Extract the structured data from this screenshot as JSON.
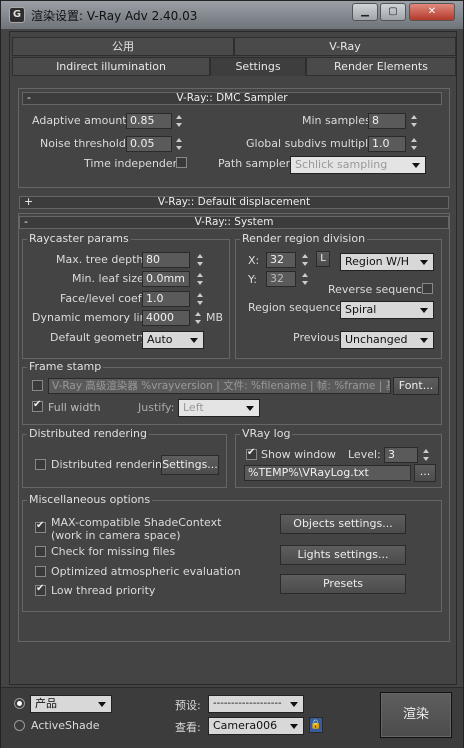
{
  "window": {
    "title": "渲染设置: V-Ray Adv 2.40.03",
    "icon": "3ds-max-icon"
  },
  "tabs_row1": [
    {
      "label": "公用"
    },
    {
      "label": "V-Ray"
    }
  ],
  "tabs_row2": [
    {
      "label": "Indirect illumination"
    },
    {
      "label": "Settings"
    },
    {
      "label": "Render Elements"
    }
  ],
  "dmc": {
    "title": "V-Ray:: DMC Sampler",
    "sign": "-",
    "adaptive_amount_label": "Adaptive amount:",
    "adaptive_amount": "0.85",
    "noise_threshold_label": "Noise threshold:",
    "noise_threshold": "0.05",
    "time_independent_label": "Time independent",
    "time_independent": false,
    "min_samples_label": "Min samples:",
    "min_samples": "8",
    "global_subdivs_label": "Global subdivs multiplier:",
    "global_subdivs": "1.0",
    "path_sampler_label": "Path sampler:",
    "path_sampler": "Schlick sampling"
  },
  "displacement": {
    "title": "V-Ray:: Default displacement",
    "sign": "+"
  },
  "system": {
    "title": "V-Ray:: System",
    "sign": "-",
    "raycaster": {
      "title": "Raycaster params",
      "max_tree_label": "Max. tree depth:",
      "max_tree": "80",
      "min_leaf_label": "Min. leaf size:",
      "min_leaf": "0.0mm",
      "face_level_label": "Face/level coef.",
      "face_level": "1.0",
      "dyn_mem_label": "Dynamic memory limit:",
      "dyn_mem": "4000",
      "dyn_mem_unit": "MB",
      "default_geom_label": "Default geometry:",
      "default_geom": "Auto"
    },
    "region": {
      "title": "Render region division",
      "x_label": "X:",
      "x": "32",
      "y_label": "Y:",
      "y": "32",
      "lock_label": "L",
      "mode": "Region W/H",
      "reverse_label": "Reverse sequence",
      "reverse": false,
      "sequence_label": "Region sequence:",
      "sequence": "Spiral",
      "previous_label": "Previous",
      "previous": "Unchanged"
    },
    "frame_stamp": {
      "title": "Frame stamp",
      "enabled": false,
      "text": "V-Ray 高级渲染器 %vrayversion | 文件: %filename | 帧: %frame | 基",
      "font_button": "Font...",
      "full_width_label": "Full width",
      "full_width": true,
      "justify_label": "Justify:",
      "justify": "Left"
    },
    "distributed": {
      "title": "Distributed rendering",
      "check_label": "Distributed rendering",
      "checked": false,
      "settings_button": "Settings..."
    },
    "vraylog": {
      "title": "VRay log",
      "show_label": "Show window",
      "show": true,
      "level_label": "Level:",
      "level": "3",
      "path": "%TEMP%\\VRayLog.txt",
      "browse": "..."
    },
    "misc": {
      "title": "Miscellaneous options",
      "max_compat_label": "MAX-compatible ShadeContext",
      "max_compat_sub": "(work in camera space)",
      "max_compat": true,
      "check_missing_label": "Check for missing files",
      "check_missing": false,
      "optimized_label": "Optimized atmospheric evaluation",
      "optimized": false,
      "low_thread_label": "Low thread priority",
      "low_thread": true,
      "objects_button": "Objects settings...",
      "lights_button": "Lights settings...",
      "presets_button": "Presets"
    }
  },
  "bottom": {
    "product_label": "产品",
    "activeshade_label": "ActiveShade",
    "preset_label": "预设:",
    "preset_value": "-------------------",
    "view_label": "查看:",
    "view_value": "Camera006",
    "render_button": "渲染"
  }
}
